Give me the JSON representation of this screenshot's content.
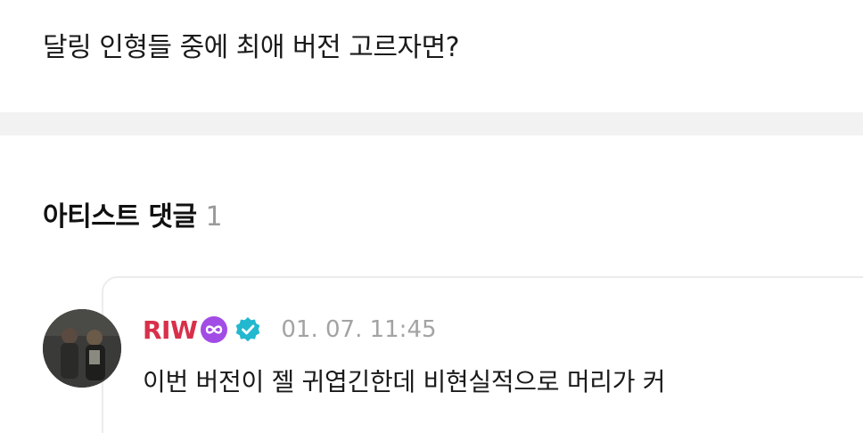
{
  "post": {
    "question": "달링 인형들 중에 최애 버전 고르자면?"
  },
  "comments_section": {
    "title": "아티스트 댓글",
    "count": "1"
  },
  "comment": {
    "author": "RIW",
    "timestamp": "01. 07. 11:45",
    "text": "이번 버전이 젤 귀엽긴한데 비현실적으로 머리가 커",
    "badge_icon": "infinity-icon",
    "verified_icon": "verified-check-icon"
  },
  "colors": {
    "author_name": "#d8304a",
    "verified_badge": "#22b8cf",
    "infinity_badge": "#a24ce6",
    "timestamp": "#a3a3a3",
    "divider": "#f2f2f2"
  }
}
